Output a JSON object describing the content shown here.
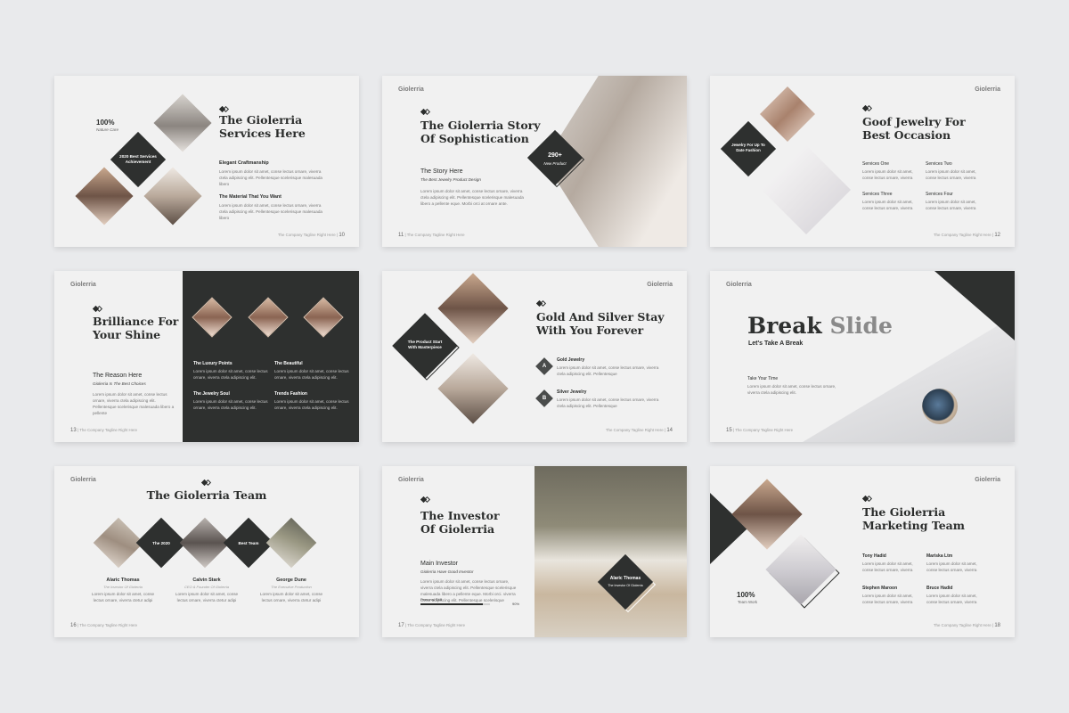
{
  "slides": [
    {
      "brand": "",
      "title": "The Giolerria\nServices Here",
      "stat_value": "100%",
      "stat_label": "Nature Care",
      "badge": "2020 Best Services\nAchievement",
      "items": [
        {
          "title": "Elegant Craftmanship",
          "text": "Lorem ipsum dolor sit amet, conse lectus ornare, viverra ctela adipiscing elit. Pellentesque scelerisque malesuada libero"
        },
        {
          "title": "The Material That You Want",
          "text": "Lorem ipsum dolor sit amet, conse lectus ornare, viverra ctela adipiscing elit. Pellentesque scelerisque malesuada libero"
        }
      ],
      "footer_text": "The Company Tagline Right Here",
      "page": "10"
    },
    {
      "brand": "Giolerria",
      "title": "The Giolerria Story\nOf Sophistication",
      "badge_value": "290+",
      "badge_label": "New Product",
      "sub_title": "The Story Here",
      "sub_caption": "The Best Jewelry Product Design",
      "text": "Lorem ipsum dolor sit amet, conse lectus ornare, viverra ctela adipiscing elit. Pellentesque scelerisque malesuada libero a pellente eque. Morbi orci at ornare ante.",
      "footer_text": "The Company Tagline Right Here",
      "page": "11"
    },
    {
      "brand": "Giolerria",
      "title": "Goof Jewelry For\nBest Occasion",
      "badge": "Jewelry For Up To\nDate Fashion",
      "services": [
        {
          "title": "Services One",
          "text": "Lorem ipsum dolor sit amet, conse lectus ornare, viverra"
        },
        {
          "title": "Services Two",
          "text": "Lorem ipsum dolor sit amet, conse lectus ornare, viverra"
        },
        {
          "title": "Services Three",
          "text": "Lorem ipsum dolor sit amet, conse lectus ornare, viverra"
        },
        {
          "title": "Services Four",
          "text": "Lorem ipsum dolor sit amet, conse lectus ornare, viverra"
        }
      ],
      "footer_text": "The Company Tagline Right Here",
      "page": "12"
    },
    {
      "brand": "Giolerria",
      "title": "Brilliance For\nYour Shine",
      "sub_title": "The Reason Here",
      "sub_caption": "Giolerria Is The Best Choices",
      "text": "Lorem ipsum dolor sit amet, conse lectus ornare, viverra ctela adipiscing elit. Pellentesque scelerisque malesuada libero a pellente",
      "points": [
        {
          "title": "The Luxury Points",
          "text": "Lorem ipsum dolor sit amet, conse lectus ornare, viverra ctela adipiscing elit."
        },
        {
          "title": "The Beautiful",
          "text": "Lorem ipsum dolor sit amet, conse lectus ornare, viverra ctela adipiscing elit."
        },
        {
          "title": "The Jewelry Soul",
          "text": "Lorem ipsum dolor sit amet, conse lectus ornare, viverra ctela adipiscing elit."
        },
        {
          "title": "Trends Fashion",
          "text": "Lorem ipsum dolor sit amet, conse lectus ornare, viverra ctela adipiscing elit."
        }
      ],
      "footer_text": "The Company Tagline Right Here",
      "page": "13"
    },
    {
      "brand": "Giolerria",
      "title": "Gold And Silver Stay\nWith You Forever",
      "badge": "The Product Start\nWith Masterpiece",
      "items": [
        {
          "letter": "A",
          "title": "Gold Jewelry",
          "text": "Lorem ipsum dolor sit amet, conse lectus ornare, viverra ctela adipiscing elit. Pellentesque"
        },
        {
          "letter": "B",
          "title": "Silver Jewelry",
          "text": "Lorem ipsum dolor sit amet, conse lectus ornare, viverra ctela adipiscing elit. Pellentesque"
        }
      ],
      "footer_text": "The Company Tagline Right Here",
      "page": "14"
    },
    {
      "brand": "Giolerria",
      "title_dark": "Break",
      "title_light": "Slide",
      "subtitle": "Let's Take A Break",
      "sub_title": "Take Your Time",
      "text": "Lorem ipsum dolor sit amet, conse lectus ornare, viverra ctela adipiscing elit.",
      "footer_text": "The Company Tagline Right Here",
      "page": "15"
    },
    {
      "brand": "Giolerria",
      "title": "The Giolerria Team",
      "labels": [
        "The 2020",
        "Best Team"
      ],
      "members": [
        {
          "name": "Alaric Thomas",
          "role": "The Investor Of Giolerria",
          "text": "Lorem ipsum dolor sit amet, conse lectus ornare, viverra ctetur adipi"
        },
        {
          "name": "Calvin Stark",
          "role": "CEO & Founder Of Giolerria",
          "text": "Lorem ipsum dolor sit amet, conse lectus ornare, viverra ctetur adipi"
        },
        {
          "name": "George Dune",
          "role": "The Executive Production",
          "text": "Lorem ipsum dolor sit amet, conse lectus ornare, viverra ctetur adipi"
        }
      ],
      "footer_text": "The Company Tagline Right Here",
      "page": "16"
    },
    {
      "brand": "Giolerria",
      "title": "The Investor\nOf Giolerria",
      "sub_title": "Main Investor",
      "sub_caption": "Giolerria Have Good Investor",
      "text": "Lorem ipsum dolor sit amet, conse lectus ornare, viverra ctela adipiscing elit. Pellentesque scelerisque malesuada libero a pellente eque. Morbi orci. viverra ctetur adipiscing elit. Pellentesque scelerisque",
      "bar_label": "Personal Skill",
      "bar_value": "90%",
      "bar_fraction": 0.9,
      "name_badge": "Alaric Thomas",
      "name_role": "The Investor Of Giolerria",
      "footer_text": "The Company Tagline Right Here",
      "page": "17"
    },
    {
      "brand": "Giolerria",
      "title": "The Giolerria\nMarketing Team",
      "stat_value": "100%",
      "stat_label": "Team Work",
      "members": [
        {
          "name": "Tony Hadid",
          "text": "Lorem ipsum dolor sit amet, conse lectus ornare, viverra"
        },
        {
          "name": "Mariska Ltm",
          "text": "Lorem ipsum dolor sit amet, conse lectus ornare, viverra"
        },
        {
          "name": "Stephen Maroon",
          "text": "Lorem ipsum dolor sit amet, conse lectus ornare, viverra"
        },
        {
          "name": "Bruce Hadid",
          "text": "Lorem ipsum dolor sit amet, conse lectus ornare, viverra"
        }
      ],
      "footer_text": "The Company Tagline Right Here",
      "page": "18"
    }
  ],
  "colors": {
    "dark": "#2e302f",
    "background": "#e9eaec",
    "slide": "#f1f1f1"
  },
  "icons": [
    "diamond-logo-icon"
  ]
}
